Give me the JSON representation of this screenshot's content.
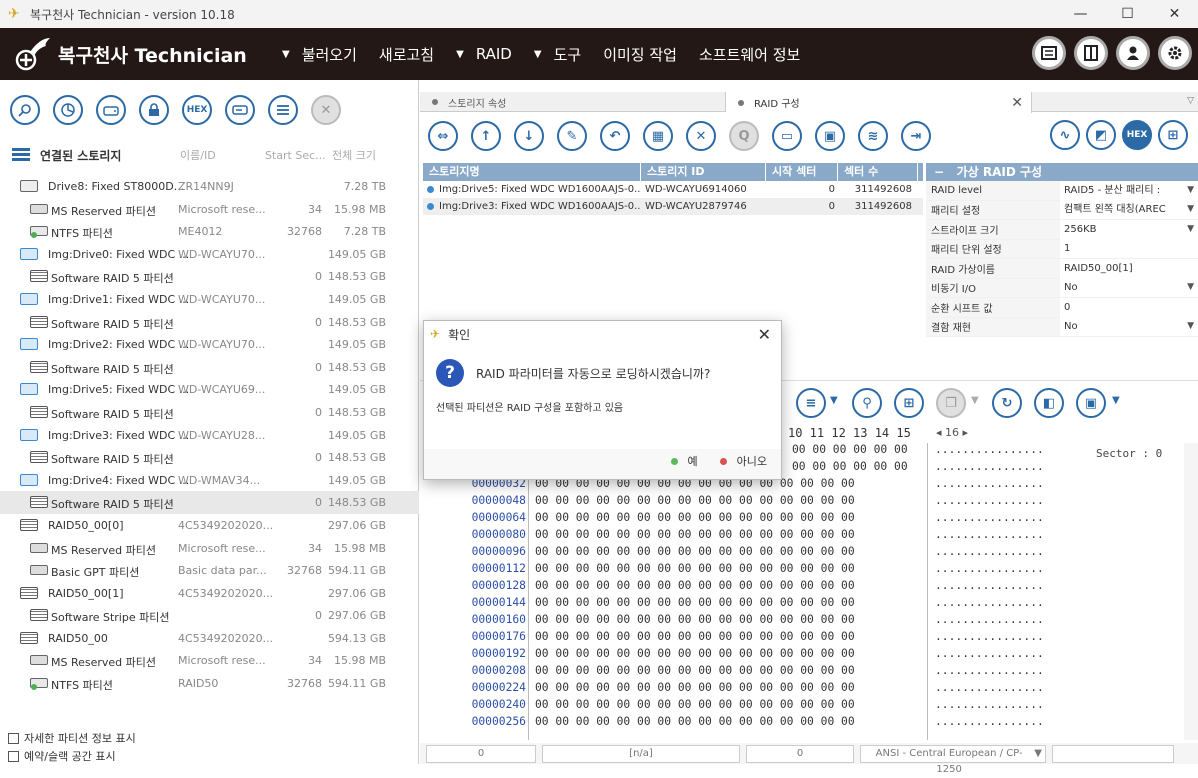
{
  "window": {
    "title": "복구천사 Technician - version 10.18",
    "min": "—",
    "max": "☐",
    "close": "✕"
  },
  "brand": "복구천사 Technician",
  "menu": [
    {
      "label": "불러오기",
      "arrow": true
    },
    {
      "label": "새로고침",
      "arrow": false
    },
    {
      "label": "RAID",
      "arrow": true
    },
    {
      "label": "도구",
      "arrow": true
    },
    {
      "label": "이미징 작업",
      "arrow": false
    },
    {
      "label": "소프트웨어 정보",
      "arrow": false
    }
  ],
  "left": {
    "header": {
      "title": "연결된 스토리지",
      "col_id": "이름/ID",
      "col_start": "Start Sec...",
      "col_size": "전체 크기"
    },
    "rows": [
      {
        "type": "disk",
        "name": "Drive8: Fixed ST8000D...",
        "id": "ZR14NN9J",
        "start": "",
        "size": "7.28 TB"
      },
      {
        "type": "part",
        "name": "MS Reserved 파티션",
        "id": "Microsoft rese...",
        "start": "34",
        "size": "15.98 MB"
      },
      {
        "type": "ntfs",
        "name": "NTFS 파티션",
        "id": "ME4012",
        "start": "32768",
        "size": "7.28 TB"
      },
      {
        "type": "img",
        "name": "Img:Drive0: Fixed WDC ...",
        "id": "WD-WCAYU70...",
        "start": "",
        "size": "149.05 GB"
      },
      {
        "type": "raidp",
        "name": "Software RAID 5 파티션",
        "id": "",
        "start": "0",
        "size": "148.53 GB"
      },
      {
        "type": "img",
        "name": "Img:Drive1: Fixed WDC ...",
        "id": "WD-WCAYU70...",
        "start": "",
        "size": "149.05 GB"
      },
      {
        "type": "raidp",
        "name": "Software RAID 5 파티션",
        "id": "",
        "start": "0",
        "size": "148.53 GB"
      },
      {
        "type": "img",
        "name": "Img:Drive2: Fixed WDC ...",
        "id": "WD-WCAYU70...",
        "start": "",
        "size": "149.05 GB"
      },
      {
        "type": "raidp",
        "name": "Software RAID 5 파티션",
        "id": "",
        "start": "0",
        "size": "148.53 GB"
      },
      {
        "type": "img",
        "name": "Img:Drive5: Fixed WDC ...",
        "id": "WD-WCAYU69...",
        "start": "",
        "size": "149.05 GB"
      },
      {
        "type": "raidp",
        "name": "Software RAID 5 파티션",
        "id": "",
        "start": "0",
        "size": "148.53 GB"
      },
      {
        "type": "img",
        "name": "Img:Drive3: Fixed WDC ...",
        "id": "WD-WCAYU28...",
        "start": "",
        "size": "149.05 GB"
      },
      {
        "type": "raidp",
        "name": "Software RAID 5 파티션",
        "id": "",
        "start": "0",
        "size": "148.53 GB"
      },
      {
        "type": "img",
        "name": "Img:Drive4: Fixed WDC ...",
        "id": "WD-WMAV34...",
        "start": "",
        "size": "149.05 GB"
      },
      {
        "type": "raidp",
        "name": "Software RAID 5 파티션",
        "id": "",
        "start": "0",
        "size": "148.53 GB",
        "selected": true
      },
      {
        "type": "raid",
        "name": "RAID50_00[0]",
        "id": "4C5349202020...",
        "start": "",
        "size": "297.06 GB"
      },
      {
        "type": "part",
        "name": "MS Reserved 파티션",
        "id": "Microsoft rese...",
        "start": "34",
        "size": "15.98 MB"
      },
      {
        "type": "part",
        "name": "Basic GPT 파티션",
        "id": "Basic data par...",
        "start": "32768",
        "size": "594.11 GB"
      },
      {
        "type": "raid",
        "name": "RAID50_00[1]",
        "id": "4C5349202020...",
        "start": "",
        "size": "297.06 GB"
      },
      {
        "type": "raidp",
        "name": "Software Stripe 파티션",
        "id": "",
        "start": "0",
        "size": "297.06 GB"
      },
      {
        "type": "raid",
        "name": "RAID50_00",
        "id": "4C5349202020...",
        "start": "",
        "size": "594.13 GB"
      },
      {
        "type": "part",
        "name": "MS Reserved 파티션",
        "id": "Microsoft rese...",
        "start": "34",
        "size": "15.98 MB"
      },
      {
        "type": "ntfs",
        "name": "NTFS 파티션",
        "id": "RAID50",
        "start": "32768",
        "size": "594.11 GB"
      }
    ],
    "chk1": "자세한 파티션 정보 표시",
    "chk2": "예약/슬랙 공간 표시"
  },
  "tabs": [
    {
      "label": "스토리지 속성"
    },
    {
      "label": "RAID 구성"
    }
  ],
  "storage_table": {
    "headers": [
      "스토리지명",
      "스토리지 ID",
      "시작 섹터",
      "섹터 수"
    ],
    "rows": [
      {
        "name": "Img:Drive5: Fixed WDC WD1600AAJS-0...",
        "id": "WD-WCAYU6914060",
        "start": "0",
        "count": "311492608"
      },
      {
        "name": "Img:Drive3: Fixed WDC WD1600AAJS-0...",
        "id": "WD-WCAYU2879746",
        "start": "0",
        "count": "311492608"
      }
    ]
  },
  "vraid": {
    "title": "가상 RAID 구성",
    "collapse": "−",
    "rows": [
      {
        "k": "RAID level",
        "v": "RAID5 - 분산 패리티 :",
        "dd": true
      },
      {
        "k": "패리티 설정",
        "v": "컴팩트 왼쪽 대칭(AREC",
        "dd": true
      },
      {
        "k": "스트라이프 크기",
        "v": "256KB",
        "dd": true
      },
      {
        "k": "패리티 단위 설정",
        "v": "1",
        "dd": false
      },
      {
        "k": "RAID 가상이름",
        "v": "RAID50_00[1]",
        "dd": false
      },
      {
        "k": "비동기 I/O",
        "v": "No",
        "dd": true
      },
      {
        "k": "순환 시프트 값",
        "v": "0",
        "dd": false
      },
      {
        "k": "결함 재현",
        "v": "No",
        "dd": true
      }
    ]
  },
  "hex": {
    "header_cols": "10 11 12 13 14 15",
    "page": "◂  16  ▸",
    "sector_label": "Sector : 0",
    "bytes": "00 00 00 00 00 00 00 00 00 00 00 00 00 00 00 00",
    "ascii": "................",
    "partial_bytes": "00 00 00 00 00 00",
    "rows": [
      "",
      "",
      "00000032",
      "00000048",
      "00000064",
      "00000080",
      "00000096",
      "00000112",
      "00000128",
      "00000144",
      "00000160",
      "00000176",
      "00000192",
      "00000208",
      "00000224",
      "00000240",
      "00000256"
    ]
  },
  "status": {
    "s1": "0",
    "s2": "[n/a]",
    "s3": "0",
    "s4": "ANSI - Central European / CP-1250",
    "dd": "▼"
  },
  "dialog": {
    "title": "확인",
    "question": "RAID 파라미터를 자동으로 로딩하시겠습니까?",
    "sub": "선택된 파티션은 RAID 구성을 포함하고 있음",
    "yes": "예",
    "no": "아니오"
  }
}
